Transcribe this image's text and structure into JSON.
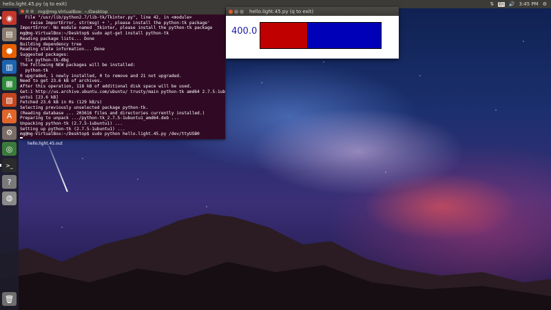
{
  "topbar": {
    "title": "hello.light.45.py (q to exit)",
    "keyboard": "En",
    "clock": "3:45 PM"
  },
  "launcher": {
    "items": [
      {
        "name": "dash",
        "glyph": "◉",
        "color": "#c2372b"
      },
      {
        "name": "files",
        "glyph": "▤",
        "color": "#8a7b6d"
      },
      {
        "name": "firefox",
        "glyph": "●",
        "color": "#e66000"
      },
      {
        "name": "writer",
        "glyph": "▥",
        "color": "#1e63b0"
      },
      {
        "name": "calc",
        "glyph": "▦",
        "color": "#2e8b3a"
      },
      {
        "name": "impress",
        "glyph": "▧",
        "color": "#c4461e"
      },
      {
        "name": "software-center",
        "glyph": "A",
        "color": "#e0662a"
      },
      {
        "name": "settings",
        "glyph": "⚙",
        "color": "#7a6d66"
      },
      {
        "name": "chrome",
        "glyph": "◎",
        "color": "#3b7a3b"
      },
      {
        "name": "terminal",
        "glyph": ">_",
        "color": "#2b2b2b"
      },
      {
        "name": "help",
        "glyph": "?",
        "color": "#7a7a7a"
      },
      {
        "name": "dvd",
        "glyph": "◍",
        "color": "#8a8a8a"
      }
    ],
    "trash": {
      "glyph": "🗑",
      "color": "#6e6e6e"
    }
  },
  "terminal": {
    "title": "mg@mg-VirtualBox: ~/Desktop",
    "lines": [
      "  File \"/usr/lib/python2.7/lib-tk/Tkinter.py\", line 42, in <module>",
      "    raise ImportError, str(msg) + ', please install the python-tk package'",
      "ImportError: No module named _tkinter, please install the python-tk package",
      "mg@mg-VirtualBox:~/Desktop$ sudo apt-get install python-tk",
      "Reading package lists... Done",
      "Building dependency tree",
      "Reading state information... Done",
      "Suggested packages:",
      "  tix python-tk-dbg",
      "The following NEW packages will be installed:",
      "  python-tk",
      "0 upgraded, 1 newly installed, 0 to remove and 21 not upgraded.",
      "Need to get 23.6 kB of archives.",
      "After this operation, 118 kB of additional disk space will be used.",
      "Get:1 http://us.archive.ubuntu.com/ubuntu/ trusty/main python-tk amd64 2.7.5-1ub",
      "untu1 [23.6 kB]",
      "Fetched 23.6 kB in 0s (129 kB/s)",
      "Selecting previously unselected package python-tk.",
      "(Reading database ... 203616 files and directories currently installed.)",
      "Preparing to unpack .../python-tk_2.7.5-1ubuntu1_amd64.deb ...",
      "Unpacking python-tk (2.7.5-1ubuntu1) ...",
      "Setting up python-tk (2.7.5-1ubuntu1) ...",
      "mg@mg-VirtualBox:~/Desktop$ sudo python hello.light.45.py /dev/ttyUSB0"
    ]
  },
  "tk_window": {
    "title": "hello.light.45.py (q to exit)",
    "value": "400.0",
    "bar_fraction": 0.39,
    "colors": {
      "red": "#c00000",
      "blue": "#0000b8"
    }
  },
  "desktop_label": "hello.light.45.out"
}
